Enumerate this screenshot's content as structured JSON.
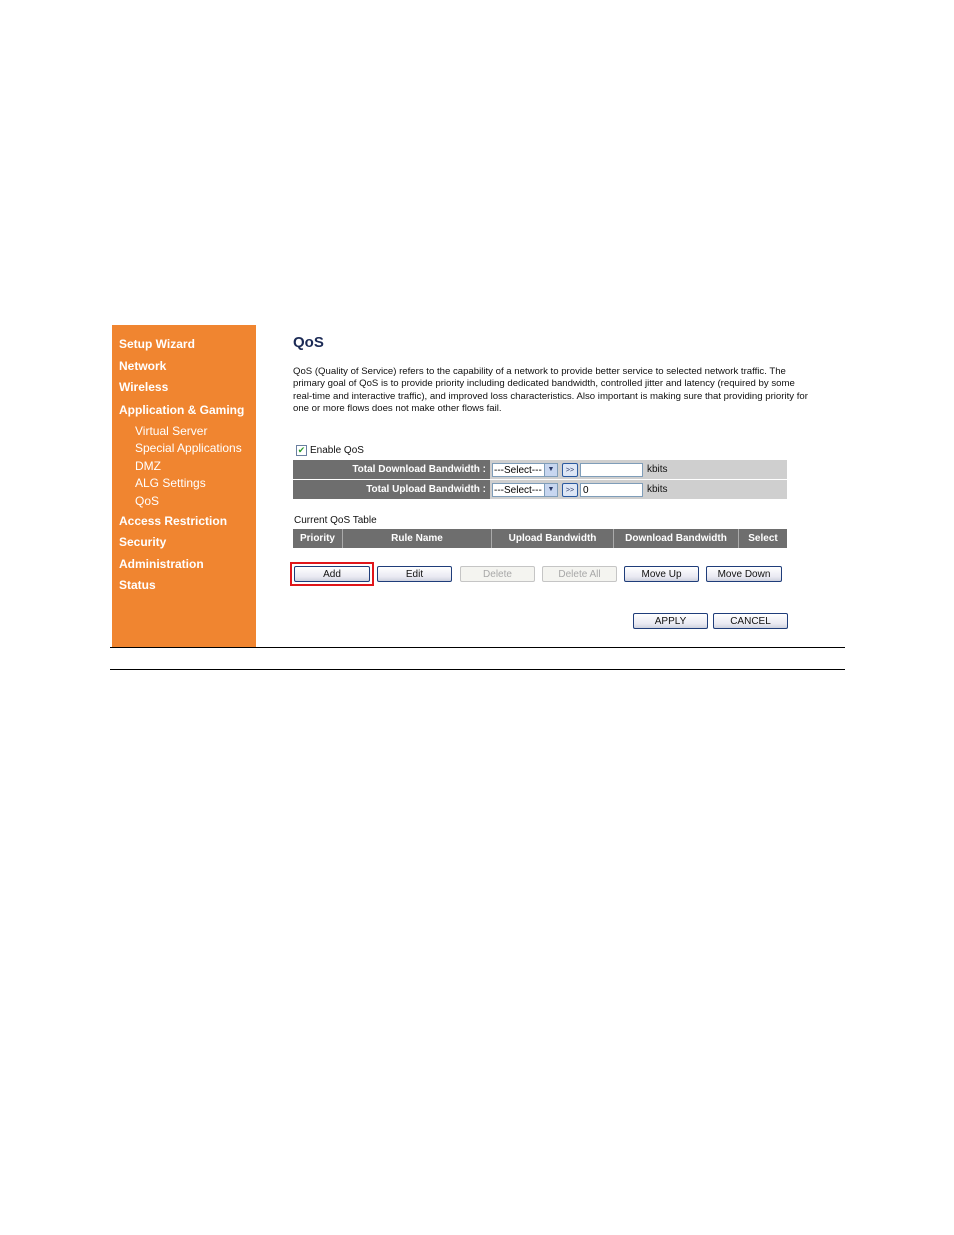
{
  "sidebar": {
    "items": [
      {
        "label": "Setup Wizard"
      },
      {
        "label": "Network"
      },
      {
        "label": "Wireless"
      },
      {
        "label": "Application & Gaming"
      },
      {
        "label": "Virtual Server"
      },
      {
        "label": "Special Applications"
      },
      {
        "label": "DMZ"
      },
      {
        "label": "ALG Settings"
      },
      {
        "label": "QoS"
      },
      {
        "label": "Access Restriction"
      },
      {
        "label": "Security"
      },
      {
        "label": "Administration"
      },
      {
        "label": "Status"
      }
    ]
  },
  "page": {
    "title": "QoS",
    "description": "QoS (Quality of Service) refers to the capability of a network to provide better service to selected network traffic. The primary goal of QoS is to provide priority including dedicated bandwidth, controlled jitter and latency (required by some real-time and interactive traffic), and improved loss characteristics. Also important is making sure that providing priority for one or more flows does not make other flows fail.",
    "enable_qos": {
      "label": "Enable QoS",
      "checked": true,
      "mark": "✔"
    },
    "download": {
      "label": "Total Download Bandwidth :",
      "select": "---Select---",
      "go": ">>",
      "value": "",
      "unit": "kbits"
    },
    "upload": {
      "label": "Total Upload Bandwidth :",
      "select": "---Select---",
      "go": ">>",
      "value": "0",
      "unit": "kbits"
    },
    "table": {
      "caption": "Current QoS Table",
      "columns": [
        "Priority",
        "Rule Name",
        "Upload Bandwidth",
        "Download Bandwidth",
        "Select"
      ],
      "rows": []
    },
    "buttons": {
      "add": "Add",
      "edit": "Edit",
      "delete": "Delete",
      "delete_all": "Delete All",
      "move_up": "Move Up",
      "move_down": "Move Down",
      "apply": "APPLY",
      "cancel": "CANCEL"
    },
    "highlight_color": "#e0161b",
    "sidebar_color": "#f08530",
    "arrow_glyph": "▼"
  }
}
